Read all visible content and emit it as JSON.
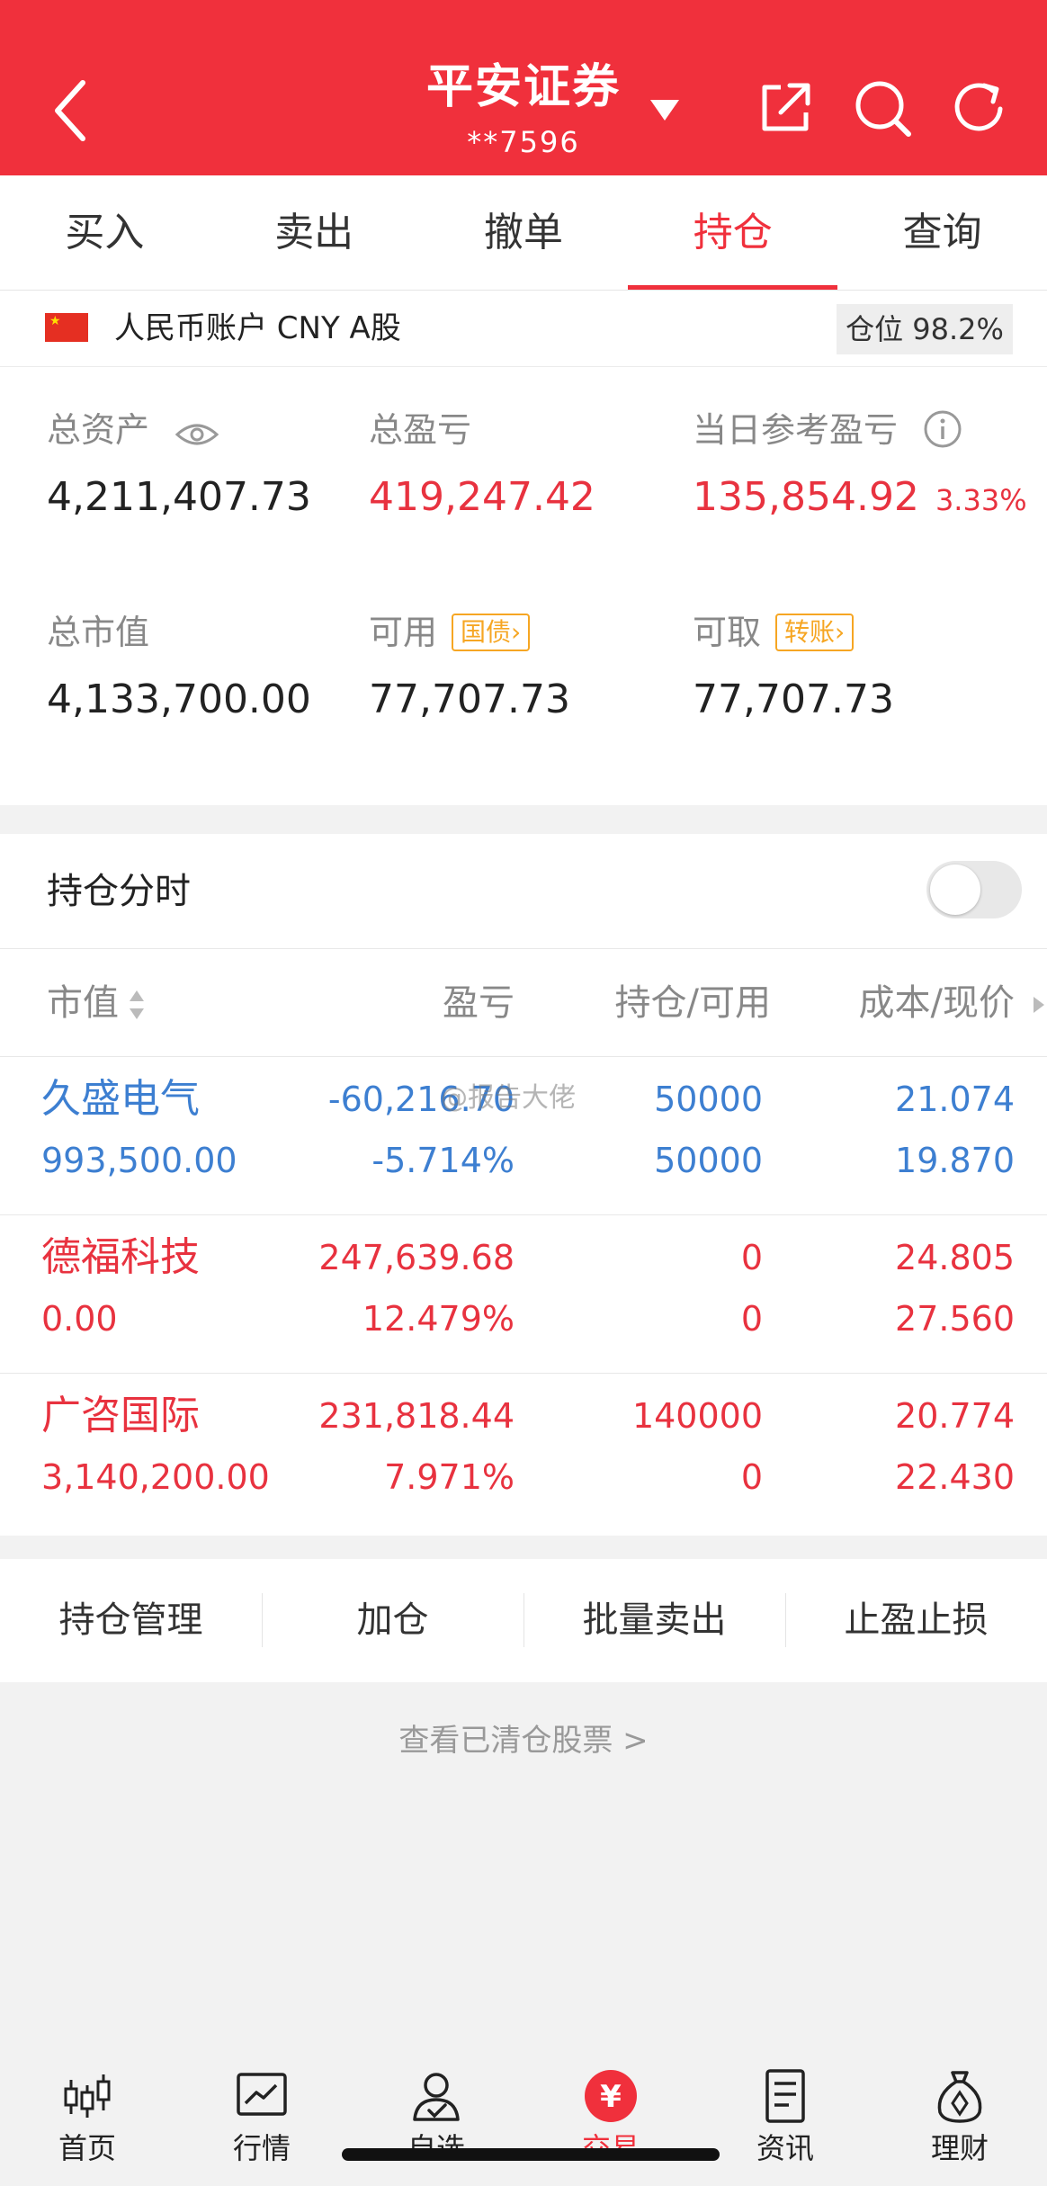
{
  "header": {
    "title": "平安证券",
    "account_masked": "**7596",
    "colors": {
      "brand": "#f0303c"
    },
    "icons": [
      "back-arrow-icon",
      "dropdown-caret-icon",
      "share-icon",
      "search-icon",
      "refresh-icon"
    ]
  },
  "tabs": [
    {
      "label": "买入",
      "active": false
    },
    {
      "label": "卖出",
      "active": false
    },
    {
      "label": "撤单",
      "active": false
    },
    {
      "label": "持仓",
      "active": true
    },
    {
      "label": "查询",
      "active": false
    }
  ],
  "account": {
    "label": "人民币账户 CNY A股",
    "position_badge": "仓位 98.2%"
  },
  "metrics": {
    "total_assets": {
      "label": "总资产",
      "value": "4,211,407.73"
    },
    "total_pnl": {
      "label": "总盈亏",
      "value": "419,247.42"
    },
    "daily_pnl": {
      "label": "当日参考盈亏",
      "value": "135,854.92",
      "pct": "3.33%"
    },
    "market_value": {
      "label": "总市值",
      "value": "4,133,700.00"
    },
    "available": {
      "label": "可用",
      "tag": "国债",
      "value": "77,707.73"
    },
    "withdrawable": {
      "label": "可取",
      "tag": "转账",
      "value": "77,707.73"
    }
  },
  "holdings": {
    "title": "持仓分时",
    "toggle_on": false,
    "columns": {
      "market_value": "市值",
      "pnl": "盈亏",
      "position": "持仓/可用",
      "cost": "成本/现价"
    },
    "rows": [
      {
        "name": "久盛电气",
        "market_value": "993,500.00",
        "pnl": "-60,216.70",
        "pnl_pct": "-5.714%",
        "position": "50000",
        "available": "50000",
        "cost": "21.074",
        "price": "19.870",
        "color": "#3d7fd1"
      },
      {
        "name": "德福科技",
        "market_value": "0.00",
        "pnl": "247,639.68",
        "pnl_pct": "12.479%",
        "position": "0",
        "available": "0",
        "cost": "24.805",
        "price": "27.560",
        "color": "#e8323f"
      },
      {
        "name": "广咨国际",
        "market_value": "3,140,200.00",
        "pnl": "231,818.44",
        "pnl_pct": "7.971%",
        "position": "140000",
        "available": "0",
        "cost": "20.774",
        "price": "22.430",
        "color": "#e8323f"
      }
    ]
  },
  "actions": [
    "持仓管理",
    "加仓",
    "批量卖出",
    "止盈止损"
  ],
  "cleared_link": "查看已清仓股票  >",
  "watermark": "@报告大佬",
  "bottom_nav": [
    {
      "label": "首页",
      "icon": "candlestick-icon",
      "active": false
    },
    {
      "label": "行情",
      "icon": "chart-icon",
      "active": false
    },
    {
      "label": "自选",
      "icon": "user-check-icon",
      "active": false
    },
    {
      "label": "交易",
      "icon": "yuan-icon",
      "active": true
    },
    {
      "label": "资讯",
      "icon": "document-icon",
      "active": false
    },
    {
      "label": "理财",
      "icon": "money-bag-icon",
      "active": false
    }
  ]
}
